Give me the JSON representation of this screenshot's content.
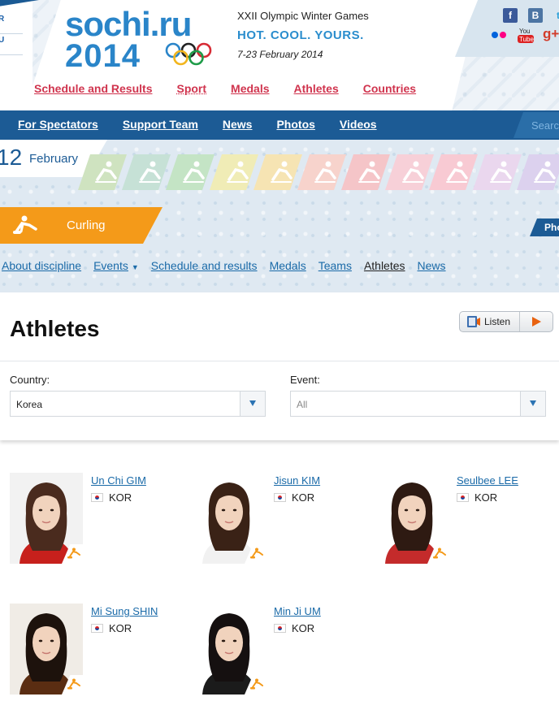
{
  "header": {
    "left_links": [
      "R",
      "U"
    ],
    "logo": {
      "text_line1": "sochi.ru",
      "text_line2": "2014"
    },
    "games_title": "XXII Olympic Winter Games",
    "slogan": "HOT. COOL. YOURS.",
    "dates": "7-23 February 2014",
    "social": [
      "facebook",
      "vkontakte",
      "twitter",
      "flickr",
      "youtube",
      "google-plus"
    ],
    "nav": [
      "Schedule and Results",
      "Sport",
      "Medals",
      "Athletes",
      "Countries"
    ]
  },
  "blue_bar": {
    "nav": [
      "For Spectators",
      "Support Team",
      "News",
      "Photos",
      "Videos"
    ],
    "search_placeholder": "Search"
  },
  "date_strip": {
    "day": "12",
    "month": "February",
    "tile_colors": [
      "#cfe3c0",
      "#c6e1d6",
      "#c4e4c5",
      "#f0ecb6",
      "#f6e4b3",
      "#f7d3cc",
      "#f5c5c8",
      "#f7d0d8",
      "#f8cad3",
      "#ead7ee",
      "#dcd1ee"
    ]
  },
  "discipline": {
    "name": "Curling",
    "photo_tab": "Pho",
    "sub_nav": [
      "About discipline",
      "Events",
      "Schedule and results",
      "Medals",
      "Teams",
      "Athletes",
      "News"
    ],
    "active_sub_nav": "Athletes"
  },
  "page": {
    "title": "Athletes",
    "listen_label": "Listen",
    "country_label": "Country:",
    "country_value": "Korea",
    "event_label": "Event:",
    "event_value": "All"
  },
  "athletes": [
    {
      "name": "Un Chi GIM",
      "country": "KOR"
    },
    {
      "name": "Jisun KIM",
      "country": "KOR"
    },
    {
      "name": "Seulbee LEE",
      "country": "KOR"
    },
    {
      "name": "Mi Sung SHIN",
      "country": "KOR"
    },
    {
      "name": "Min Ji UM",
      "country": "KOR"
    }
  ],
  "colors": {
    "brand_blue": "#1c5b95",
    "accent_red": "#d0344e",
    "curling_orange": "#f49a19",
    "link_blue": "#1a6aa8"
  }
}
